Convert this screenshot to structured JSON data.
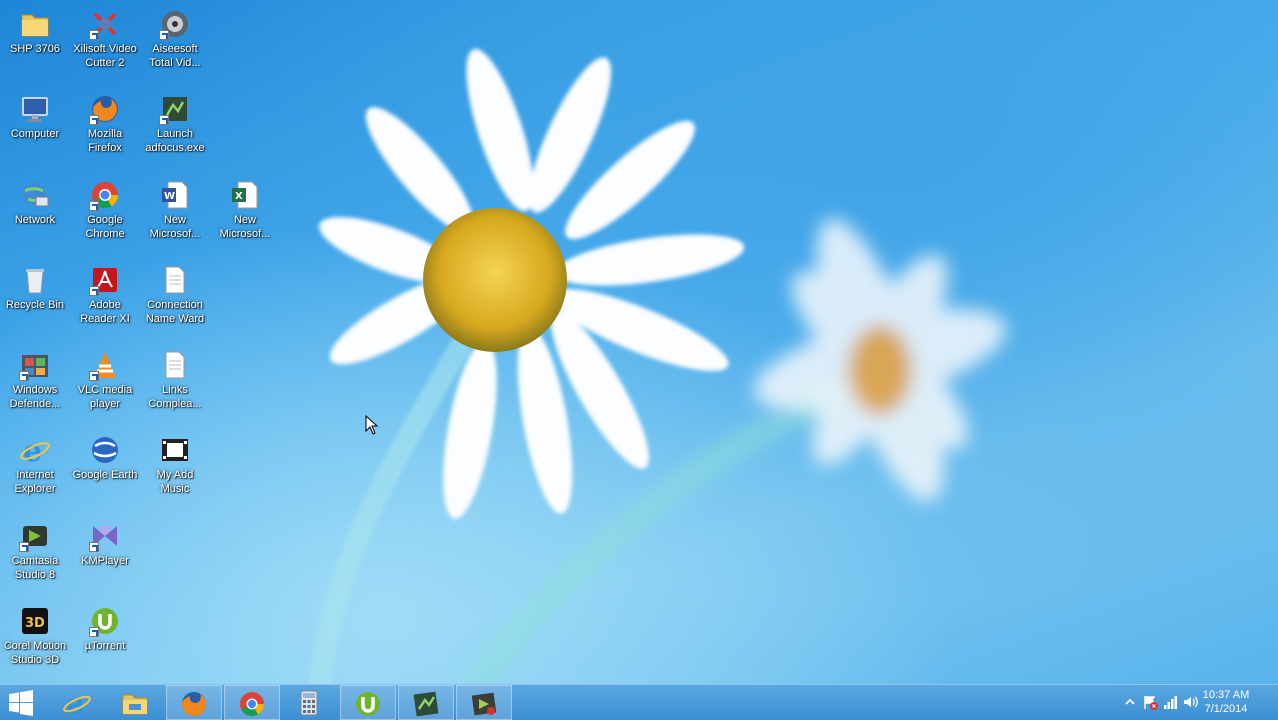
{
  "desktop": {
    "icons": [
      {
        "label": "SHP 3706",
        "icon": "folder-icon"
      },
      {
        "label": "Computer",
        "icon": "computer-icon"
      },
      {
        "label": "Network",
        "icon": "network-icon"
      },
      {
        "label": "Recycle Bin",
        "icon": "recycle-bin-icon"
      },
      {
        "label": "Windows Defende...",
        "icon": "windows-defender-icon"
      },
      {
        "label": "Internet Explorer",
        "icon": "internet-explorer-icon"
      },
      {
        "label": "Camtasia Studio 8",
        "icon": "camtasia-icon"
      },
      {
        "label": "Corel Motion Studio 3D",
        "icon": "corel-3d-icon"
      },
      {
        "label": "Xilisoft Video Cutter 2",
        "icon": "xilisoft-icon"
      },
      {
        "label": "Mozilla Firefox",
        "icon": "firefox-icon"
      },
      {
        "label": "Google Chrome",
        "icon": "chrome-icon"
      },
      {
        "label": "Adobe Reader XI",
        "icon": "adobe-reader-icon"
      },
      {
        "label": "VLC media player",
        "icon": "vlc-icon"
      },
      {
        "label": "Google Earth",
        "icon": "google-earth-icon"
      },
      {
        "label": "KMPlayer",
        "icon": "kmplayer-icon"
      },
      {
        "label": "µTorrent",
        "icon": "utorrent-icon"
      },
      {
        "label": "Aiseesoft Total Vid...",
        "icon": "aiseesoft-icon"
      },
      {
        "label": "Launch adfocus.exe",
        "icon": "adfocus-icon"
      },
      {
        "label": "New Microsof...",
        "icon": "word-document-icon"
      },
      {
        "label": "Connection Name Ward",
        "icon": "text-file-icon"
      },
      {
        "label": "Links Complea...",
        "icon": "text-file-icon"
      },
      {
        "label": "My Add Music",
        "icon": "film-icon"
      },
      {
        "label": "New Microsof...",
        "icon": "excel-spreadsheet-icon"
      }
    ]
  },
  "taskbar": {
    "start_icon": "windows-logo-icon",
    "pinned": [
      {
        "icon": "internet-explorer-icon",
        "running": false
      },
      {
        "icon": "file-explorer-icon",
        "running": false
      },
      {
        "icon": "firefox-icon",
        "running": true
      },
      {
        "icon": "chrome-icon",
        "running": true
      },
      {
        "icon": "calculator-icon",
        "running": false
      },
      {
        "icon": "utorrent-icon",
        "running": true
      },
      {
        "icon": "adfocus-icon",
        "running": true
      },
      {
        "icon": "camtasia-recorder-icon",
        "running": true
      }
    ],
    "tray": {
      "icons": [
        "show-hidden-icons-chevron",
        "action-center-flag-icon",
        "network-signal-icon",
        "volume-icon"
      ],
      "time": "10:37 AM",
      "date": "7/1/2014"
    }
  },
  "colors": {
    "sky_blue": "#48acec",
    "taskbar_blue": "#4a9ad9",
    "flower_center": "#e2b82a"
  }
}
